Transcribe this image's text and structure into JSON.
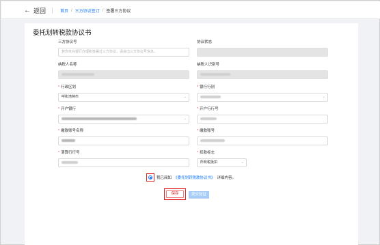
{
  "header": {
    "back_label": "返回",
    "breadcrumb": [
      "首页",
      "三方协议签订",
      "签署三方协议"
    ],
    "breadcrumb_sep": "/"
  },
  "card": {
    "title": "委托划转税款协议书"
  },
  "form": {
    "agreement_no_label": "三方协议号",
    "agreement_no_placeholder": "若你未在银行办理和签署过三方协议，请会出三方协议号信息。",
    "agreement_status_label": "协议状态",
    "taxpayer_name_label": "纳税人名称",
    "taxpayer_id_label": "纳税人识别号",
    "region_label": "行政区划",
    "region_value": "呼和浩特市",
    "bank_category_label": "银行行别",
    "open_bank_label": "开户银行",
    "open_bank_code_label": "开户行行号",
    "payer_account_name_label": "缴款账号名称",
    "payer_account_no_label": "缴款账号",
    "clearing_bank_label": "清算行行号",
    "deduct_flag_label": "扣款标志",
    "deduct_flag_value": "所有税批扣"
  },
  "agreement": {
    "prefix": "我已阅知",
    "doc": "《委托划转税款协议书》",
    "suffix": "详细内容。"
  },
  "buttons": {
    "save": "保存",
    "submit": "提交验证"
  },
  "colors": {
    "accent": "#1677ff",
    "highlight": "#e02020",
    "required": "#ff4d4f"
  }
}
